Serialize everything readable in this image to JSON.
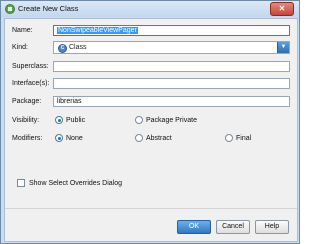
{
  "window": {
    "title": "Create New Class",
    "close_glyph": "✕"
  },
  "form": {
    "name": {
      "label": "Name:",
      "value": "NonSwipeableViewPager"
    },
    "kind": {
      "label": "Kind:",
      "value": "Class",
      "icon": "class-icon",
      "icon_glyph": "C",
      "arrow_glyph": "▼"
    },
    "superclass": {
      "label": "Superclass:",
      "value": ""
    },
    "interfaces": {
      "label": "Interface(s):",
      "value": ""
    },
    "package": {
      "label": "Package:",
      "value": "librerias"
    },
    "visibility": {
      "label": "Visibility:",
      "options": [
        "Public",
        "Package Private"
      ],
      "selected": "Public"
    },
    "modifiers": {
      "label": "Modifiers:",
      "options": [
        "None",
        "Abstract",
        "Final"
      ],
      "selected": "None"
    },
    "show_overrides": {
      "label": "Show Select Overrides Dialog",
      "checked": false
    }
  },
  "buttons": {
    "ok": "OK",
    "cancel": "Cancel",
    "help": "Help"
  },
  "colors": {
    "accent": "#2f78c4",
    "title_bar": "#c9dcf0",
    "selection": "#3399ff"
  }
}
